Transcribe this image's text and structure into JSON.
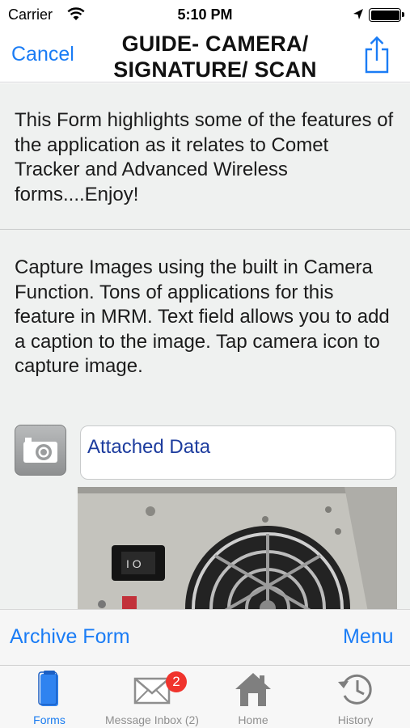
{
  "status_bar": {
    "carrier": "Carrier",
    "time": "5:10 PM",
    "battery_level": 1.0
  },
  "nav": {
    "cancel_label": "Cancel",
    "title_line1": "GUIDE- CAMERA/",
    "title_line2": "SIGNATURE/ SCAN",
    "share_icon": "share-icon"
  },
  "content": {
    "intro_text": "This Form highlights some of the features of the application as it relates to Comet Tracker and Advanced Wireless forms....Enjoy!",
    "capture_text": "Capture Images using the built in Camera Function.  Tons of applications for this feature in MRM. Text field allows you to add a caption to the image. Tap camera icon to capture image.",
    "attached_data_text": "Attached Data",
    "camera_icon": "camera-icon"
  },
  "toolbar": {
    "archive_label": "Archive Form",
    "menu_label": "Menu"
  },
  "tabs": [
    {
      "label": "Forms",
      "icon": "forms-icon",
      "active": true
    },
    {
      "label": "Message Inbox (2)",
      "icon": "mail-icon",
      "badge": "2"
    },
    {
      "label": "Home",
      "icon": "home-icon"
    },
    {
      "label": "History",
      "icon": "history-icon"
    }
  ],
  "colors": {
    "accent": "#1a7cf5",
    "badge": "#f0342d",
    "content_bg": "#eff1f0",
    "attached_text": "#1d3c9e"
  }
}
